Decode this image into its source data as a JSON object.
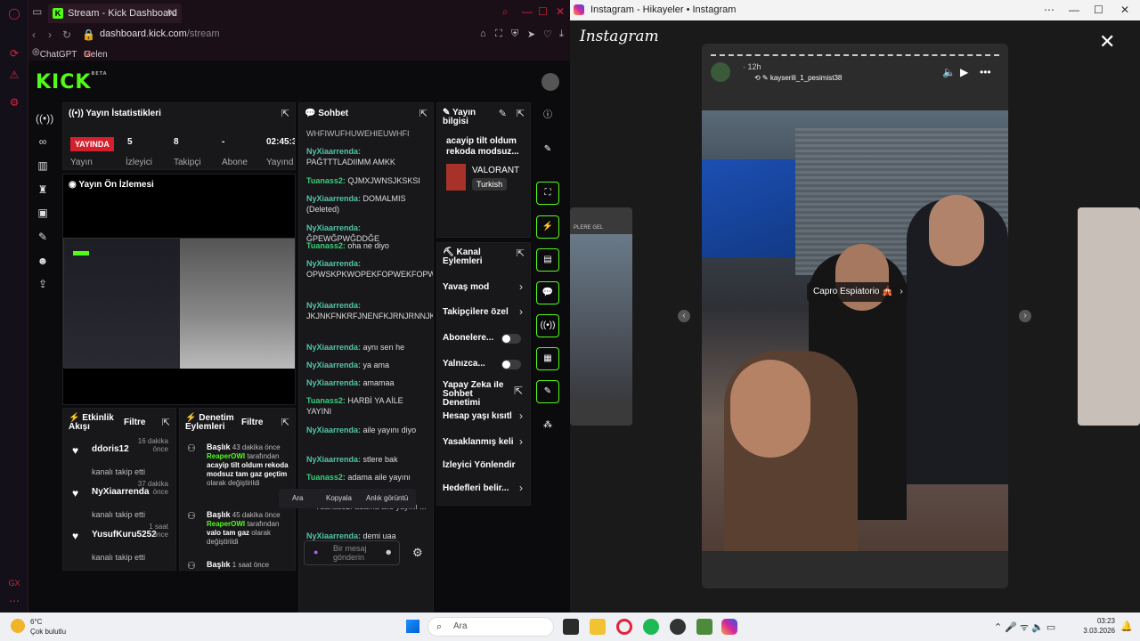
{
  "left_browser": {
    "tab_title": "Stream - Kick Dashboard",
    "url_host": "dashboard.kick.com",
    "url_path": "/stream",
    "bookmarks": [
      "ChatGPT",
      "Gelen Kutusu (431..."
    ]
  },
  "kick": {
    "logo": "KICK",
    "logo_sup": "BETA",
    "stats": {
      "title": "Yayın İstatistikleri",
      "live_label": "YAYINDA",
      "values": [
        "5",
        "8",
        "-",
        "02:45:3"
      ],
      "labels": [
        "Yayın",
        "İzleyici",
        "Takipçi",
        "Abone",
        "Yayınd"
      ]
    },
    "preview_title": "Yayın Ön İzlemesi",
    "chat": {
      "title": "Sohbet",
      "messages": [
        {
          "user": "",
          "text": "WHFIWUFHUWEHIEUWHFI",
          "cls": "n"
        },
        {
          "user": "NyXiaarrenda:",
          "text": "PAĞTTTLADIIMM AMKK",
          "cls": ""
        },
        {
          "user": "Tuanass2:",
          "text": "QJMXJWNSJKSKSI",
          "cls": "t"
        },
        {
          "user": "NyXiaarrenda:",
          "text": "DOMALMIS (Deleted)",
          "cls": ""
        },
        {
          "user": "NyXiaarrenda:",
          "text": "ĞPEWĞPWĞDDĞE",
          "cls": ""
        },
        {
          "user": "Tuanass2:",
          "text": "oha ne diyo",
          "cls": "t"
        },
        {
          "user": "NyXiaarrenda:",
          "text": "OPWSKPKWOPEKFOPWEKFOPWKOPFKJWOPFKJOPW",
          "cls": ""
        },
        {
          "user": "NyXiaarrenda:",
          "text": "JKJNKFNKRFJNENFKJRNJRNNJKNKENFENFKNREKJF",
          "cls": ""
        },
        {
          "user": "NyXiaarrenda:",
          "text": "aynı sen he",
          "cls": ""
        },
        {
          "user": "NyXiaarrenda:",
          "text": "ya ama",
          "cls": ""
        },
        {
          "user": "NyXiaarrenda:",
          "text": "amamaa",
          "cls": ""
        },
        {
          "user": "Tuanass2:",
          "text": "HARBİ YA AİLE YAYINI",
          "cls": "t"
        },
        {
          "user": "NyXiaarrenda:",
          "text": "aile yayını diyo",
          "cls": ""
        },
        {
          "user": "NyXiaarrenda:",
          "text": "stlere bak",
          "cls": ""
        },
        {
          "user": "Tuanass2:",
          "text": "adama aile yayını",
          "cls": "t"
        },
        {
          "user": "",
          "text": "↪ Tuanass2: adama aile yayını ...",
          "cls": "n"
        },
        {
          "user": "NyXiaarrenda:",
          "text": "demi uaa",
          "cls": ""
        }
      ],
      "input_placeholder": "Bir mesaj gönderin"
    },
    "context_menu": [
      "Ara",
      "Kopyala",
      "Anlık görüntü"
    ],
    "stream_info": {
      "title": "Yayın bilgisi",
      "stream_title": "acayip tilt oldum rekoda modsuz...",
      "category": "VALORANT",
      "language": "Turkish"
    },
    "channel_actions": {
      "title": "Kanal Eylemleri",
      "items": [
        {
          "label": "Yavaş mod",
          "kind": "arrow"
        },
        {
          "label": "Takipçilere özel",
          "kind": "arrow"
        },
        {
          "label": "Abonelere...",
          "kind": "toggle"
        },
        {
          "label": "Yalnızca...",
          "kind": "toggle"
        },
        {
          "label": "Yapay Zeka ile Sohbet Denetimi",
          "kind": "ext"
        },
        {
          "label": "Hesap yaşı kısıtl",
          "kind": "arrow"
        },
        {
          "label": "Yasaklanmış keli",
          "kind": "arrow"
        },
        {
          "label": "İzleyici Yönlendir",
          "kind": "none"
        },
        {
          "label": "Hedefleri belir...",
          "kind": "arrow"
        }
      ]
    },
    "activity": {
      "title": "Etkinlik Akışı",
      "filter": "Filtre",
      "items": [
        {
          "name": "ddoris12",
          "sub": "kanalı takip etti",
          "time": "16 dakika önce"
        },
        {
          "name": "NyXiaarrenda",
          "sub": "kanalı takip etti",
          "time": "37 dakika önce"
        },
        {
          "name": "YusufKuru5252",
          "sub": "kanalı takip etti",
          "time": "1 saat önce"
        }
      ]
    },
    "moderation": {
      "title": "Denetim Eylemleri",
      "filter": "Filtre",
      "items": [
        {
          "head": "Başlık",
          "time": "43 dakika önce",
          "actor": "ReaperOWI",
          "tail": "tarafından",
          "body": "acayip tilt oldum rekoda modsuz tam gaz geçtim",
          "end": "olarak değiştirildi"
        },
        {
          "head": "Başlık",
          "time": "45 dakika önce",
          "actor": "ReaperOWI",
          "tail": "tarafından",
          "body": "valo tam gaz",
          "end": "olarak değiştirildi"
        },
        {
          "head": "Başlık",
          "time": "1 saat önce",
          "actor": "",
          "tail": "",
          "body": "",
          "end": ""
        }
      ]
    }
  },
  "instagram": {
    "window_title": "Instagram - Hikayeler • Instagram",
    "logo": "Instagram",
    "story_time": "12h",
    "story_user": "kayserili_1_pesimist38",
    "location_tag": "Capro Espiatorio 🎪",
    "side_text": "PLERE GEL"
  },
  "taskbar": {
    "weather_temp": "6°C",
    "weather_desc": "Çok bulutlu",
    "search_placeholder": "Ara",
    "time": "03:23",
    "date": "3.03.2026"
  }
}
